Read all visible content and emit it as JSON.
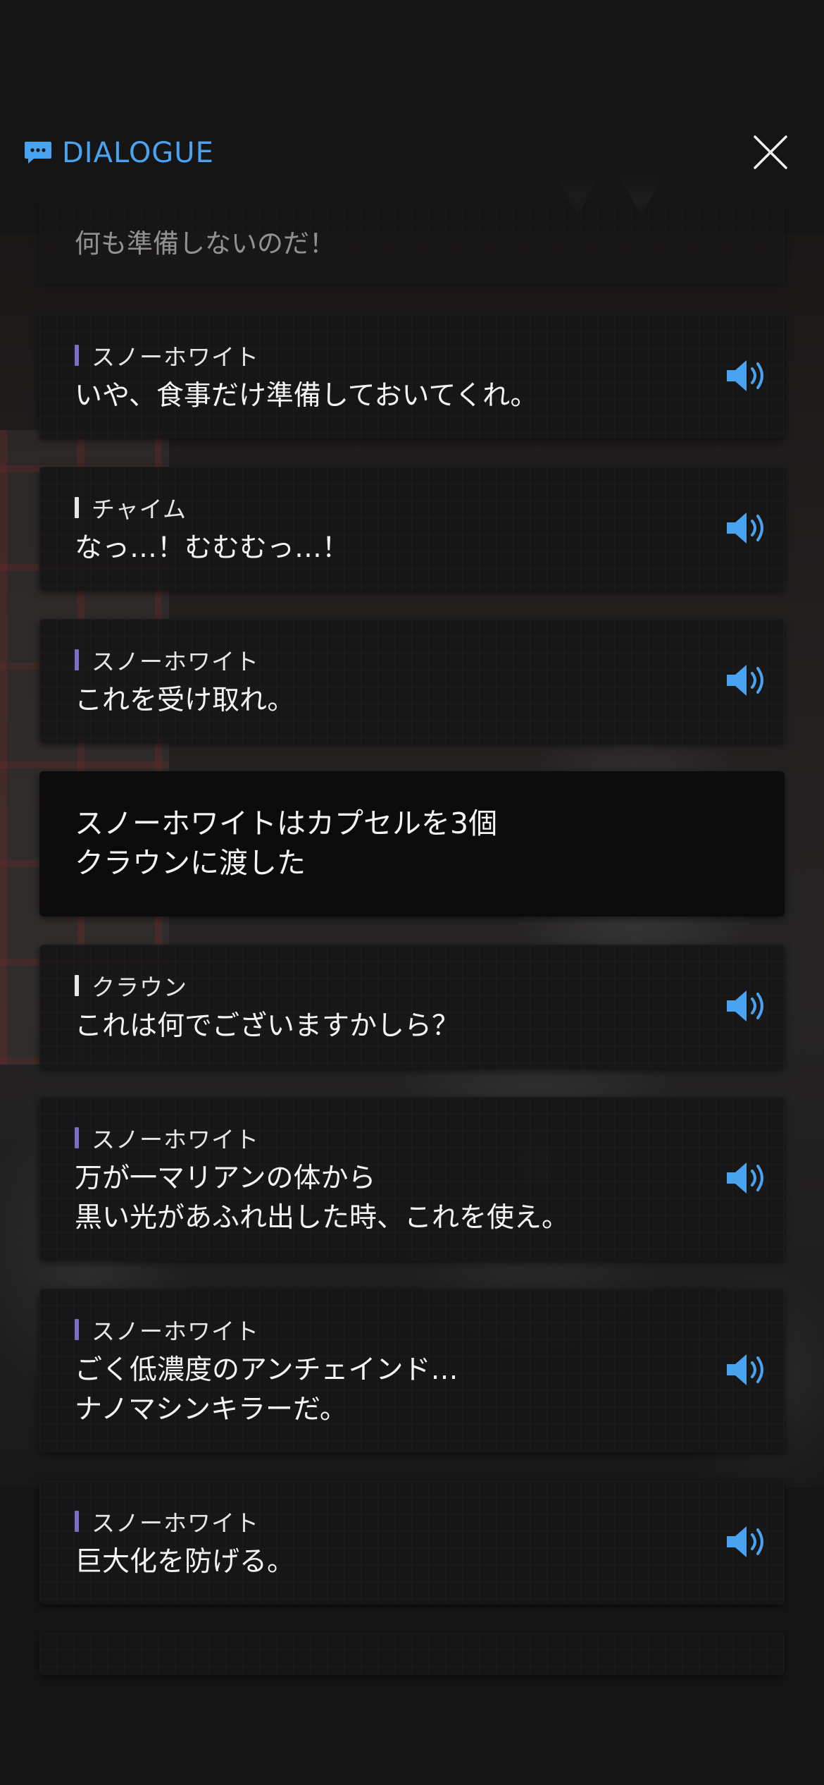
{
  "header": {
    "title": "DIALOGUE",
    "title_icon": "chat-bubble-icon",
    "close_icon": "close-icon",
    "accent_color": "#4aa3f0"
  },
  "voice_icon": "speaker-volume-icon",
  "speaker_bar_colors": {
    "purple": "#7a6ec8",
    "white": "#e8e8e8"
  },
  "dialogue": [
    {
      "type": "line",
      "speaker": "",
      "text": [
        "何も準備しないのだ！"
      ],
      "voice": false
    },
    {
      "type": "line",
      "speaker": "スノーホワイト",
      "bar": "purple",
      "text": [
        "いや、食事だけ準備しておいてくれ。"
      ],
      "voice": true
    },
    {
      "type": "line",
      "speaker": "チャイム",
      "bar": "white",
      "text": [
        "なっ…！むむむっ…！"
      ],
      "voice": true
    },
    {
      "type": "line",
      "speaker": "スノーホワイト",
      "bar": "purple",
      "text": [
        "これを受け取れ。"
      ],
      "voice": true
    },
    {
      "type": "narration",
      "text": [
        "スノーホワイトはカプセルを3個",
        "クラウンに渡した"
      ]
    },
    {
      "type": "line",
      "speaker": "クラウン",
      "bar": "white",
      "text": [
        "これは何でございますかしら？"
      ],
      "voice": true
    },
    {
      "type": "line",
      "speaker": "スノーホワイト",
      "bar": "purple",
      "text": [
        "万が一マリアンの体から",
        "黒い光があふれ出した時、これを使え。"
      ],
      "voice": true
    },
    {
      "type": "line",
      "speaker": "スノーホワイト",
      "bar": "purple",
      "text": [
        "ごく低濃度のアンチェインド…",
        "ナノマシンキラーだ。"
      ],
      "voice": true
    },
    {
      "type": "line",
      "speaker": "スノーホワイト",
      "bar": "purple",
      "text": [
        "巨大化を防げる。"
      ],
      "voice": true
    }
  ]
}
